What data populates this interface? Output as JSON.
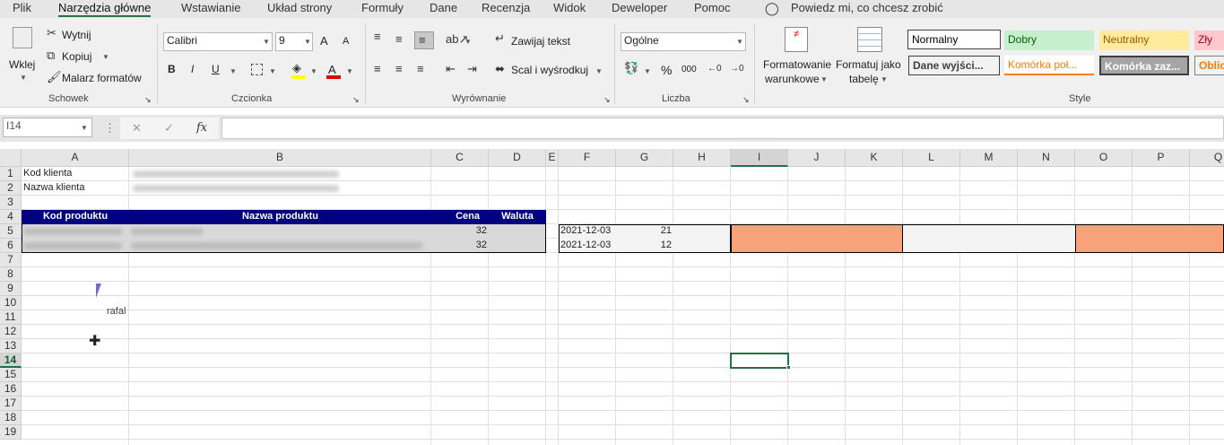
{
  "tabs": [
    "Plik",
    "Narzędzia główne",
    "Wstawianie",
    "Układ strony",
    "Formuły",
    "Dane",
    "Recenzja",
    "Widok",
    "Deweloper",
    "Pomoc"
  ],
  "tell_me": "Powiedz mi, co chcesz zrobić",
  "clipboard": {
    "paste": "Wklej",
    "cut": "Wytnij",
    "copy": "Kopiuj",
    "painter": "Malarz formatów",
    "label": "Schowek"
  },
  "font": {
    "name": "Calibri",
    "size": "9",
    "label": "Czcionka",
    "bold": "B",
    "italic": "I",
    "underline": "U",
    "grow": "A",
    "shrink": "A",
    "color_letter": "A"
  },
  "alignment": {
    "wrap": "Zawijaj tekst",
    "merge": "Scal i wyśrodkuj",
    "label": "Wyrównanie"
  },
  "number": {
    "format": "Ogólne",
    "label": "Liczba",
    "percent": "%",
    "thousands": "000"
  },
  "styles": {
    "cond_format_1": "Formatowanie",
    "cond_format_2": "warunkowe",
    "table_fmt_1": "Formatuj jako",
    "table_fmt_2": "tabelę",
    "items": [
      "Normalny",
      "Dobry",
      "Neutralny",
      "Zły",
      "Dane wyjści...",
      "Komórka poł...",
      "Komórka zaz...",
      "Oblic"
    ],
    "label": "Style",
    "colors": {
      "good_bg": "#c6efce",
      "good_fg": "#006100",
      "neutral_bg": "#ffeb9c",
      "neutral_fg": "#9c5700",
      "bad_bg": "#ffc7ce",
      "bad_fg": "#9c0006"
    }
  },
  "formula_bar": {
    "name_box": "I14",
    "cancel": "✕",
    "enter": "✓",
    "fx": "fx",
    "value": ""
  },
  "columns": [
    "A",
    "B",
    "C",
    "D",
    "E",
    "F",
    "G",
    "H",
    "I",
    "J",
    "K",
    "L",
    "M",
    "N",
    "O",
    "P",
    "Q"
  ],
  "rows": [
    "1",
    "2",
    "3",
    "4",
    "5",
    "6",
    "7",
    "8",
    "9",
    "10",
    "11",
    "12",
    "13",
    "14",
    "15",
    "16",
    "17",
    "18",
    "19"
  ],
  "selected": {
    "column": "I",
    "row": "14"
  },
  "cells": {
    "A1": "Kod klienta",
    "A2": "Nazwa klienta",
    "A4": "Kod produktu",
    "B4": "Nazwa produktu",
    "C4": "Cena",
    "D4": "Waluta",
    "C5": "32",
    "C6": "32",
    "F5": "2021-12-03",
    "G5": "21",
    "F6": "2021-12-03",
    "G6": "12",
    "cursor_label": "rafal"
  },
  "colors": {
    "header_band": "#000080",
    "orange_fill": "#f8a27c",
    "accent": "#217346"
  }
}
